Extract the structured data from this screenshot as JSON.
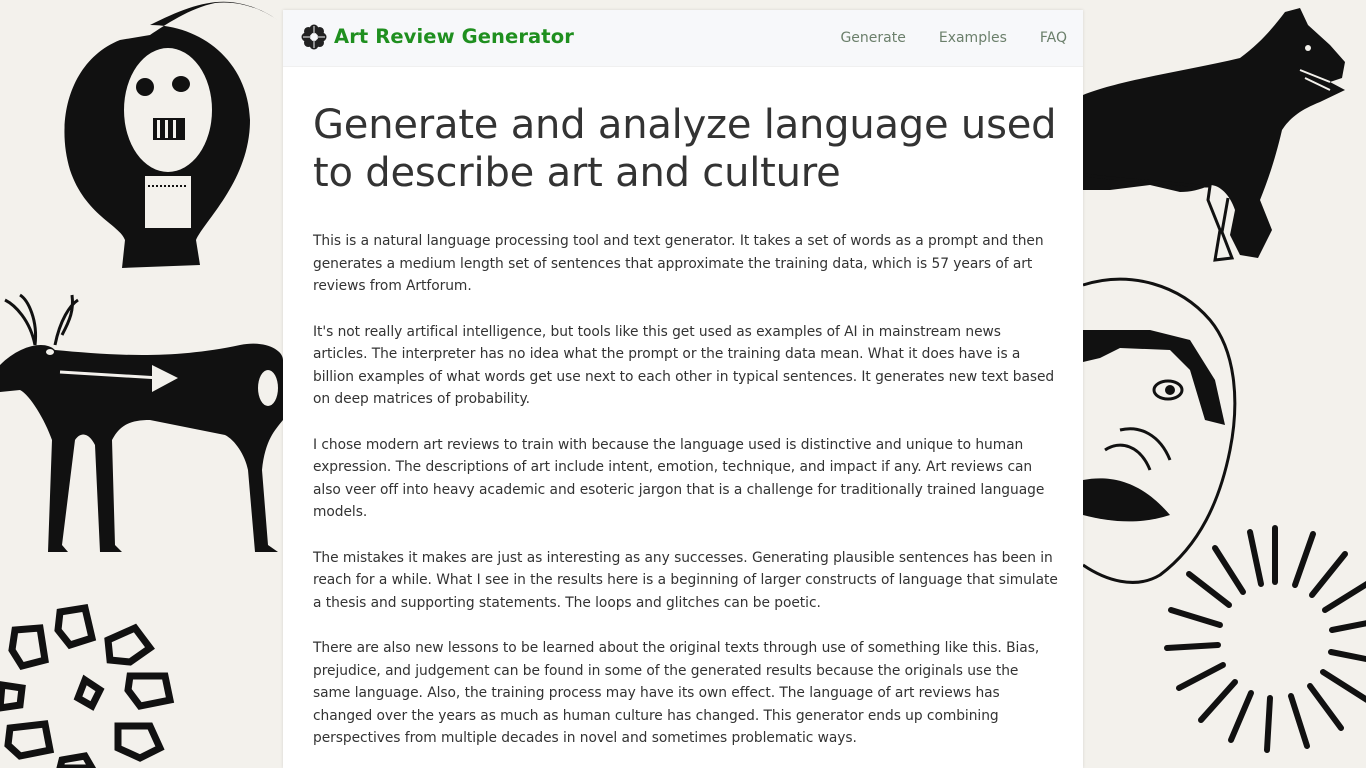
{
  "header": {
    "brand_title": "Art Review Generator",
    "brand_logo_icon": "flower-medallion-icon",
    "nav": [
      {
        "label": "Generate"
      },
      {
        "label": "Examples"
      },
      {
        "label": "FAQ"
      }
    ]
  },
  "main": {
    "headline": "Generate and analyze language used to describe art and culture",
    "paragraphs": [
      "This is a natural language processing tool and text generator. It takes a set of words as a prompt and then generates a medium length set of sentences that approximate the training data, which is 57 years of art reviews from Artforum.",
      "It's not really artifical intelligence, but tools like this get used as examples of AI in mainstream news articles. The interpreter has no idea what the prompt or the training data mean. What it does have is a billion examples of what words get use next to each other in typical sentences. It generates new text based on deep matrices of probability.",
      "I chose modern art reviews to train with because the language used is distinctive and unique to human expression. The descriptions of art include intent, emotion, technique, and impact if any. Art reviews can also veer off into heavy academic and esoteric jargon that is a challenge for traditionally trained language models.",
      "The mistakes it makes are just as interesting as any successes. Generating plausible sentences has been in reach for a while. What I see in the results here is a beginning of larger constructs of language that simulate a thesis and supporting statements. The loops and glitches can be poetic.",
      "There are also new lessons to be learned about the original texts through use of something like this. Bias, prejudice, and judgement can be found in some of the generated results because the originals use the same language. Also, the training process may have its own effect. The language of art reviews has changed over the years as much as human culture has changed. This generator ends up combining perspectives from multiple decades in novel and sometimes problematic ways."
    ]
  },
  "background": {
    "illustrations": [
      "skull-figure-illustration",
      "deer-illustration",
      "scattered-shapes-illustration",
      "wolf-illustration",
      "mask-face-illustration",
      "sunburst-illustration"
    ]
  },
  "colors": {
    "brand": "#1f8f1f",
    "nav_link": "#6b7f6b",
    "text": "#333333",
    "page_bg": "#f3f1ec"
  }
}
